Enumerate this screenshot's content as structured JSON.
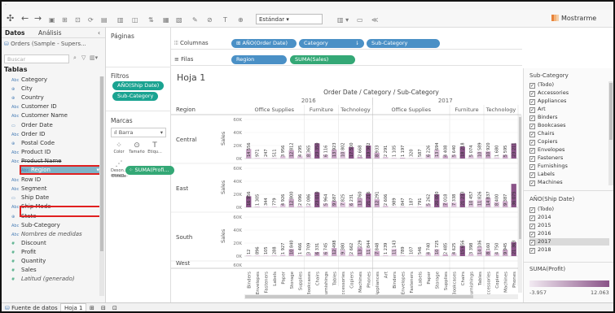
{
  "toolbar": {
    "mark_type": "Estándar",
    "show_me": "Mostrarme"
  },
  "data_pane": {
    "tab_data": "Datos",
    "tab_analytics": "Análisis",
    "source": "Orders (Sample - Supers...",
    "search_placeholder": "Buscar",
    "tables_heading": "Tablas",
    "fields": [
      {
        "type": "Abc",
        "name": "Category"
      },
      {
        "type": "⊕",
        "name": "City"
      },
      {
        "type": "⊕",
        "name": "Country"
      },
      {
        "type": "Abc",
        "name": "Customer ID"
      },
      {
        "type": "Abc",
        "name": "Customer Name"
      },
      {
        "type": "▭",
        "name": "Order Date"
      },
      {
        "type": "Abc",
        "name": "Order ID"
      },
      {
        "type": "⊕",
        "name": "Postal Code"
      },
      {
        "type": "Abc",
        "name": "Product ID"
      },
      {
        "type": "Abc",
        "name": "Product Name"
      },
      {
        "type": "Abc",
        "name": "Region"
      },
      {
        "type": "Abc",
        "name": "Row ID"
      },
      {
        "type": "Abc",
        "name": "Segment"
      },
      {
        "type": "▭",
        "name": "Ship Date"
      },
      {
        "type": "Abc",
        "name": "Ship Mode"
      },
      {
        "type": "⊕",
        "name": "State"
      },
      {
        "type": "Abc",
        "name": "Sub-Category"
      },
      {
        "type": "Abc",
        "name": "Nombres de medidas"
      },
      {
        "type": "#",
        "name": "Discount"
      },
      {
        "type": "#",
        "name": "Profit"
      },
      {
        "type": "#",
        "name": "Quantity"
      },
      {
        "type": "#",
        "name": "Sales"
      },
      {
        "type": "#",
        "name": "Latitud (generado)"
      }
    ],
    "selected_field": "Region"
  },
  "pages": {
    "title": "Páginas"
  },
  "filters": {
    "title": "Filtros",
    "pills": [
      "AÑO(Ship Date)",
      "Sub-Category"
    ]
  },
  "marks": {
    "title": "Marcas",
    "type": "Barra",
    "buttons": [
      "Color",
      "Tamaño",
      "Etiqu...",
      "Deson... amarg...",
      "Detalle"
    ],
    "color_pill": "SUMA(Profi..."
  },
  "shelves": {
    "columns_label": "Columnas",
    "columns_pills": [
      "AÑO(Order Date)",
      "Category",
      "Sub-Category"
    ],
    "rows_label": "Filas",
    "rows_pills": [
      "Region",
      "SUMA(Sales)"
    ]
  },
  "sheet": {
    "title": "Hoja 1"
  },
  "chart_data": {
    "type": "bar",
    "title": "Order Date / Category / Sub-Category",
    "row_header": "Region",
    "ylabel": "Sales",
    "ylim": [
      0,
      60000
    ],
    "yticks": [
      "60K",
      "40K",
      "20K",
      "0K"
    ],
    "years": [
      "2016",
      "2017"
    ],
    "categories": [
      {
        "name": "Office Supplies",
        "subs": [
          "Binders",
          "Envelopes",
          "Fasteners",
          "Labels",
          "Paper",
          "Storage",
          "Supplies"
        ]
      },
      {
        "name": "Furniture",
        "subs": [
          "Bookcases",
          "Chairs",
          "Furnishings",
          "Tables"
        ]
      },
      {
        "name": "Technology",
        "subs": [
          "Accessories",
          "Copiers",
          "Machines",
          "Phones"
        ]
      }
    ],
    "sub_order_2017": [
      {
        "cat": "Office Supplies",
        "subs": [
          "Appliances",
          "Art",
          "Binders",
          "Envelopes",
          "Fasteners",
          "Labels",
          "Paper",
          "Storage",
          "Supplies"
        ]
      },
      {
        "cat": "Furniture",
        "subs": [
          "Bookcases",
          "Chairs",
          "Furnishings",
          "Tables"
        ]
      },
      {
        "cat": "Technology",
        "subs": [
          "Accessories",
          "Copiers",
          "Machines",
          "Phones"
        ]
      }
    ],
    "regions": [
      {
        "name": "Central",
        "v2016": [
          14556,
          971,
          247,
          511,
          3956,
          12812,
          4295,
          8365,
          23350,
          6116,
          13923,
          10802,
          17500,
          2668,
          19902
        ],
        "v2017": [
          8933,
          2291,
          1105,
          1197,
          320,
          587,
          6226,
          13694,
          4408,
          5640,
          18218,
          5074,
          10589,
          10920,
          1680,
          5595,
          23211
        ]
      },
      {
        "name": "East",
        "v2016": [
          16956,
          1305,
          344,
          779,
          4926,
          12800,
          2096,
          2086,
          23010,
          5964,
          9687,
          7825,
          6231,
          13760,
          21216,
          32720
        ],
        "v2017": [
          12291,
          2606,
          989,
          847,
          187,
          791,
          5262,
          20000,
          7018,
          7338,
          21233,
          10457,
          11826,
          14837,
          8400,
          9387,
          36075
        ]
      },
      {
        "name": "South",
        "v2016": [
          12,
          896,
          105,
          288,
          1927,
          10840,
          1466,
          3709,
          6331,
          6745,
          12498,
          9380,
          2662,
          13229,
          11844
        ],
        "v2017": [
          7848,
          1239,
          11143,
          789,
          107,
          546,
          4740,
          10725,
          2485,
          4625,
          15656,
          3398,
          14106,
          8160,
          4750,
          9945,
          21363
        ]
      }
    ],
    "axis_subs_visible": [
      "Binders",
      "Envelopes",
      "Fasteners",
      "Labels",
      "Paper",
      "Storage",
      "Supplies",
      "Bookcases",
      "Chairs",
      "Furnishings",
      "Tables",
      "Accessories",
      "Copiers",
      "Machines",
      "Phones",
      "Appliances",
      "Art",
      "Binders",
      "Envelopes",
      "Fasteners",
      "Labels",
      "Paper",
      "Storage",
      "Supplies",
      "Bookcases",
      "Chairs",
      "Furnishings",
      "Tables",
      "Accessories",
      "Copiers",
      "Machines",
      "Phones"
    ],
    "fourth_region_partial": "West"
  },
  "right_panel": {
    "subcat_title": "Sub-Category",
    "subcat_items": [
      "(Todo)",
      "Accessories",
      "Appliances",
      "Art",
      "Binders",
      "Bookcases",
      "Chairs",
      "Copiers",
      "Envelopes",
      "Fasteners",
      "Furnishings",
      "Labels",
      "Machines"
    ],
    "year_title": "AÑO(Ship Date)",
    "year_items": [
      "(Todo)",
      "2014",
      "2015",
      "2016",
      "2017",
      "2018"
    ],
    "year_highlight": "2017",
    "profit_title": "SUMA(Profit)",
    "profit_min": "-3.957",
    "profit_max": "12.063"
  },
  "status": {
    "data_source": "Fuente de datos",
    "sheet_tab": "Hoja 1"
  },
  "colors": {
    "bar_dark": "#8a5388",
    "bar_light": "#e3cfe1",
    "teal_pill": "#1aa391",
    "blue_pill": "#4a90c6",
    "highlight": "#7fb3c6"
  }
}
